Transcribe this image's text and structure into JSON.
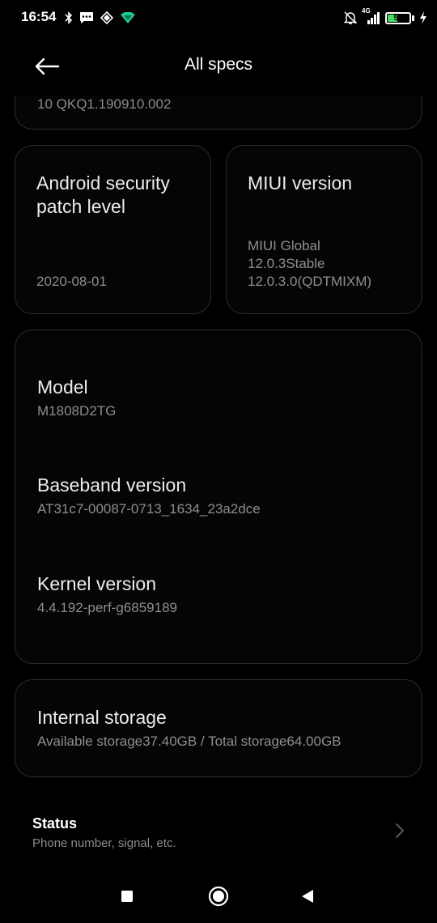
{
  "status_bar": {
    "time": "16:54",
    "network": "4G",
    "battery_level": "51",
    "battery_fraction": 0.51
  },
  "header": {
    "title": "All specs"
  },
  "top_card": {
    "partial_text": "10 QKQ1.190910.002"
  },
  "security_card": {
    "title_line1": "Android security",
    "title_line2": "patch level",
    "value": "2020-08-01"
  },
  "miui_card": {
    "title": "MIUI version",
    "value_lines": [
      "MIUI Global",
      "12.0.3Stable",
      "12.0.3.0(QDTMIXM)"
    ]
  },
  "info_card": {
    "items": [
      {
        "label": "Model",
        "value": "M1808D2TG"
      },
      {
        "label": "Baseband version",
        "value": "AT31c7-00087-0713_1634_23a2dce"
      },
      {
        "label": "Kernel version",
        "value": "4.4.192-perf-g6859189"
      }
    ]
  },
  "storage_card": {
    "label": "Internal storage",
    "value": "Available storage37.40GB / Total storage64.00GB"
  },
  "status_row": {
    "title": "Status",
    "subtitle": "Phone number, signal, etc."
  },
  "colors": {
    "background": "#000000",
    "battery_green": "#4cd964",
    "card_border": "#2c2c2c",
    "secondary_text": "#8e8e8e"
  }
}
